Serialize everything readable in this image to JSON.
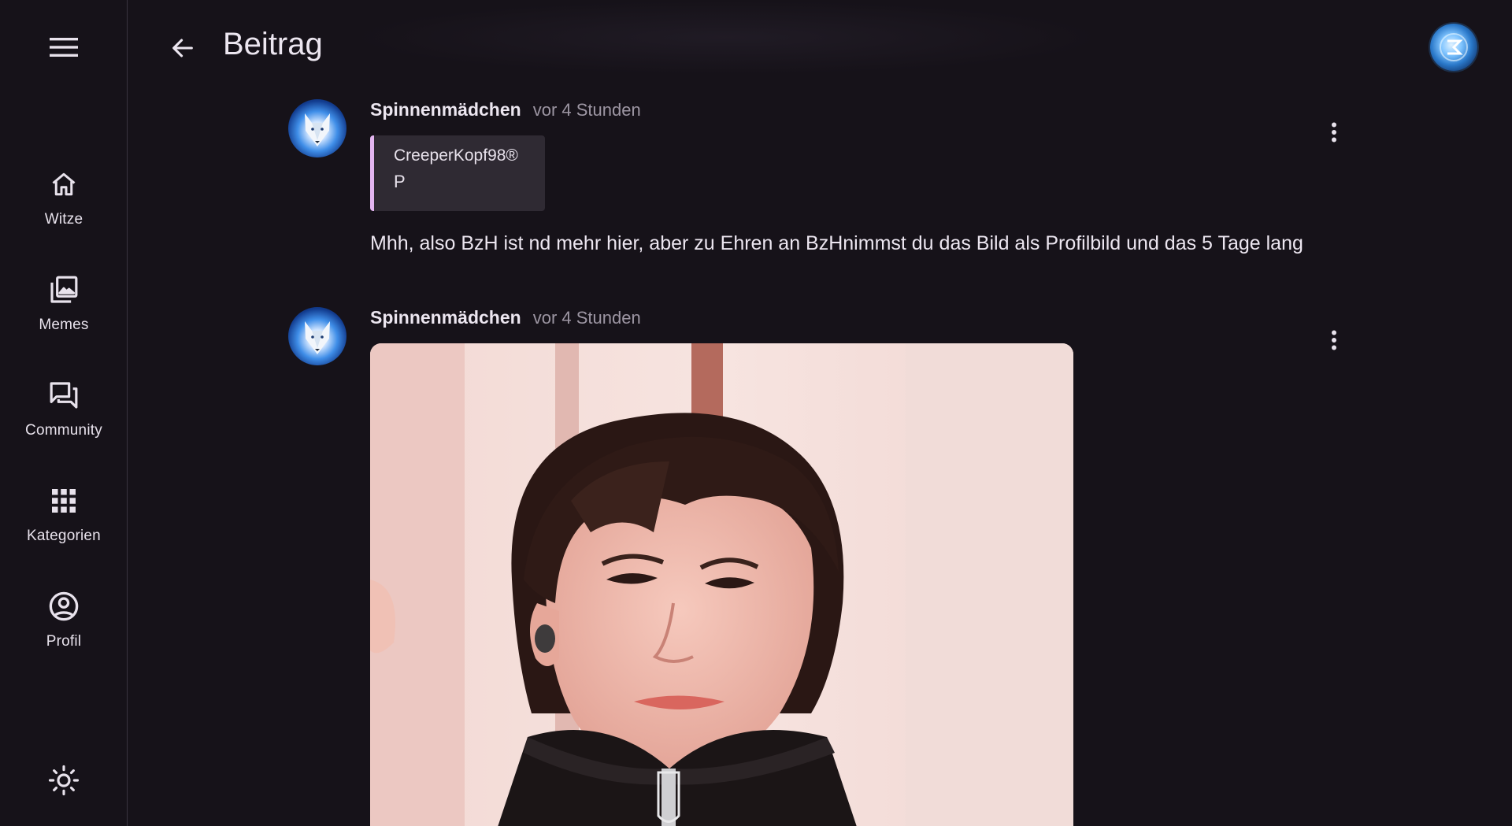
{
  "topbar": {
    "title": "Beitrag",
    "back_icon": "arrow-left-icon",
    "user_avatar_icon": "user-avatar"
  },
  "rail": {
    "menu_icon": "hamburger-menu-icon",
    "items": [
      {
        "label": "Witze",
        "icon": "home-icon"
      },
      {
        "label": "Memes",
        "icon": "photo-library-icon"
      },
      {
        "label": "Community",
        "icon": "forum-icon"
      },
      {
        "label": "Kategorien",
        "icon": "apps-grid-icon"
      },
      {
        "label": "Profil",
        "icon": "account-circle-icon"
      }
    ],
    "theme_icon": "sun-icon"
  },
  "posts": [
    {
      "author": "Spinnenmädchen",
      "time": "vor 4 Stunden",
      "quote": {
        "author": "CreeperKopf98®",
        "text": "P"
      },
      "text": "Mhh, also BzH ist nd mehr hier, aber zu Ehren an BzHnimmst du das Bild als Profilbild und das 5 Tage lang"
    },
    {
      "author": "Spinnenmädchen",
      "time": "vor 4 Stunden"
    }
  ],
  "colors": {
    "background": "#161219",
    "rail_border": "#3a3440",
    "quote_bg": "#2f2a33",
    "quote_accent": "#e3b5f0",
    "text_primary": "#ece6f0",
    "text_secondary": "#9d96a3"
  }
}
